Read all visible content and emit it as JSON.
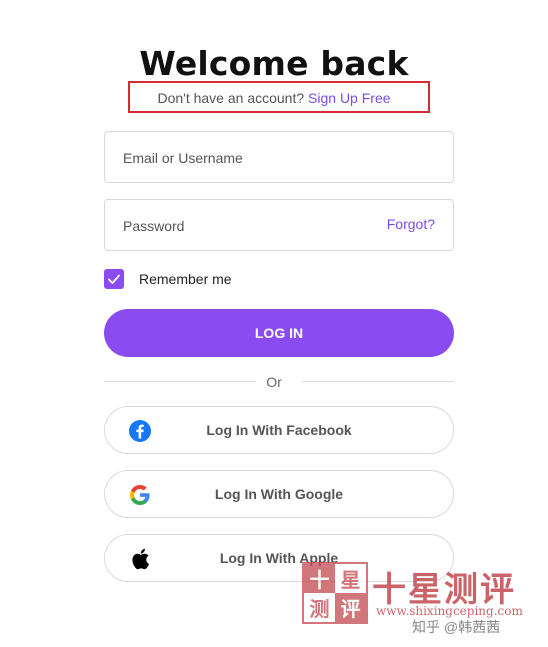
{
  "header": {
    "title": "Welcome back",
    "signup_prompt": "Don't have an account?",
    "signup_link": "Sign Up Free"
  },
  "form": {
    "username_placeholder": "Email or Username",
    "username_value": "",
    "password_placeholder": "Password",
    "password_value": "",
    "forgot_label": "Forgot?",
    "remember_label": "Remember me",
    "remember_checked": true,
    "login_label": "LOG IN"
  },
  "divider": {
    "label": "Or"
  },
  "social": [
    {
      "label": "Log In With Facebook",
      "icon": "facebook-icon"
    },
    {
      "label": "Log In With Google",
      "icon": "google-icon"
    },
    {
      "label": "Log In With Apple",
      "icon": "apple-icon"
    }
  ],
  "colors": {
    "accent": "#8a4cf1",
    "link": "#7a4de0",
    "annotation_box": "#d42b34",
    "watermark": "#c24a4f"
  },
  "watermark": {
    "seal_chars": [
      "十",
      "星",
      "测",
      "评"
    ],
    "brand": "十星测评",
    "url": "www.shixingceping.com",
    "credit": "知乎 @韩茜茜"
  }
}
